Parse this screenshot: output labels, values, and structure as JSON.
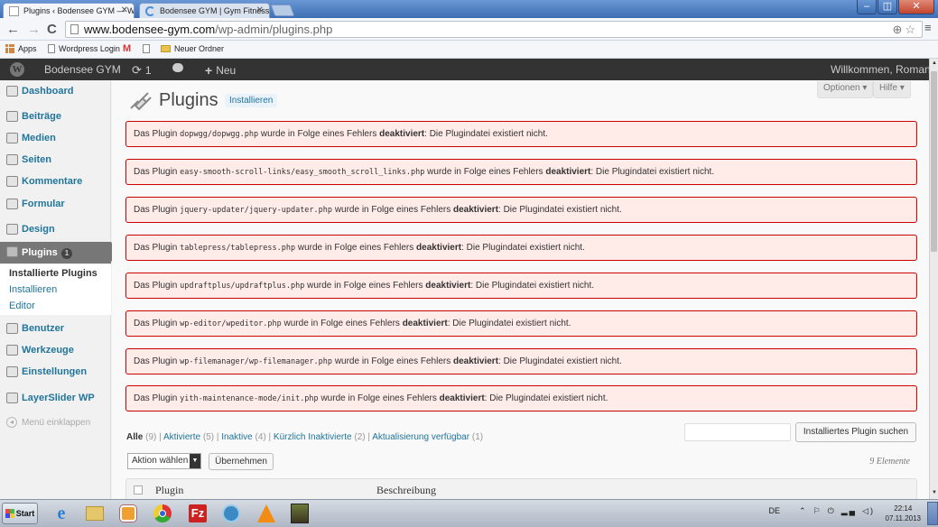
{
  "browser": {
    "tabs": [
      {
        "title": "Plugins ‹ Bodensee GYM — W"
      },
      {
        "title": "Bodensee GYM | Gym Fitness"
      }
    ],
    "window_controls": {
      "minimize": "–",
      "maximize": "◫",
      "close": "✕"
    },
    "url": {
      "host": "www.bodensee-gym.com",
      "path": "/wp-admin/plugins.php"
    },
    "bookmarks": [
      {
        "label": "Apps"
      },
      {
        "label": "Wordpress Login"
      },
      {
        "label": ""
      },
      {
        "label": ""
      },
      {
        "label": "Neuer Ordner"
      }
    ]
  },
  "adminbar": {
    "site_name": "Bodensee GYM",
    "updates_count": "1",
    "new_label": "Neu",
    "greeting": "Willkommen, Roman"
  },
  "sidebar": {
    "items": [
      {
        "label": "Dashboard",
        "icon": "home-icon"
      },
      {
        "label": "Beiträge",
        "icon": "pin-icon"
      },
      {
        "label": "Medien",
        "icon": "media-icon"
      },
      {
        "label": "Seiten",
        "icon": "page-icon"
      },
      {
        "label": "Kommentare",
        "icon": "comment-icon"
      },
      {
        "label": "Formular",
        "icon": "form-icon"
      },
      {
        "label": "Design",
        "icon": "appearance-icon"
      },
      {
        "label": "Plugins",
        "icon": "plugin-icon",
        "badge": "1"
      },
      {
        "label": "Benutzer",
        "icon": "users-icon"
      },
      {
        "label": "Werkzeuge",
        "icon": "tools-icon"
      },
      {
        "label": "Einstellungen",
        "icon": "settings-icon"
      },
      {
        "label": "LayerSlider WP",
        "icon": "layerslider-icon"
      }
    ],
    "submenu": [
      {
        "label": "Installierte Plugins"
      },
      {
        "label": "Installieren"
      },
      {
        "label": "Editor"
      }
    ],
    "collapse_label": "Menü einklappen"
  },
  "main": {
    "title": "Plugins",
    "add_new": "Installieren",
    "screen_options": "Optionen ▾",
    "help": "Hilfe ▾",
    "notices": [
      {
        "prefix": "Das Plugin",
        "file": "dopwgg/dopwgg.php",
        "middle": "wurde in Folge eines Fehlers",
        "bold": "deaktiviert",
        "suffix": ": Die Plugindatei existiert nicht."
      },
      {
        "prefix": "Das Plugin",
        "file": "easy-smooth-scroll-links/easy_smooth_scroll_links.php",
        "middle": "wurde in Folge eines Fehlers",
        "bold": "deaktiviert",
        "suffix": ": Die Plugindatei existiert nicht."
      },
      {
        "prefix": "Das Plugin",
        "file": "jquery-updater/jquery-updater.php",
        "middle": "wurde in Folge eines Fehlers",
        "bold": "deaktiviert",
        "suffix": ": Die Plugindatei existiert nicht."
      },
      {
        "prefix": "Das Plugin",
        "file": "tablepress/tablepress.php",
        "middle": "wurde in Folge eines Fehlers",
        "bold": "deaktiviert",
        "suffix": ": Die Plugindatei existiert nicht."
      },
      {
        "prefix": "Das Plugin",
        "file": "updraftplus/updraftplus.php",
        "middle": "wurde in Folge eines Fehlers",
        "bold": "deaktiviert",
        "suffix": ": Die Plugindatei existiert nicht."
      },
      {
        "prefix": "Das Plugin",
        "file": "wp-editor/wpeditor.php",
        "middle": "wurde in Folge eines Fehlers",
        "bold": "deaktiviert",
        "suffix": ": Die Plugindatei existiert nicht."
      },
      {
        "prefix": "Das Plugin",
        "file": "wp-filemanager/wp-filemanager.php",
        "middle": "wurde in Folge eines Fehlers",
        "bold": "deaktiviert",
        "suffix": ": Die Plugindatei existiert nicht."
      },
      {
        "prefix": "Das Plugin",
        "file": "yith-maintenance-mode/init.php",
        "middle": "wurde in Folge eines Fehlers",
        "bold": "deaktiviert",
        "suffix": ": Die Plugindatei existiert nicht."
      }
    ],
    "filters": [
      {
        "label": "Alle",
        "count": "(9)"
      },
      {
        "label": "Aktivierte",
        "count": "(5)"
      },
      {
        "label": "Inaktive",
        "count": "(4)"
      },
      {
        "label": "Kürzlich Inaktivierte",
        "count": "(2)"
      },
      {
        "label": "Aktualisierung verfügbar",
        "count": "(1)"
      }
    ],
    "search_button": "Installiertes Plugin suchen",
    "bulk_action": "Aktion wählen",
    "apply_button": "Übernehmen",
    "items_count": "9 Elemente",
    "table_headers": [
      "Plugin",
      "Beschreibung"
    ]
  },
  "taskbar": {
    "start_label": "Start",
    "apps": [
      "internet-explorer-icon",
      "file-explorer-icon",
      "media-player-icon",
      "chrome-icon",
      "filezilla-icon",
      "network-icon",
      "vlc-icon",
      "mona-lisa-icon"
    ],
    "language": "DE",
    "time": "22:14",
    "date": "07.11.2013"
  }
}
